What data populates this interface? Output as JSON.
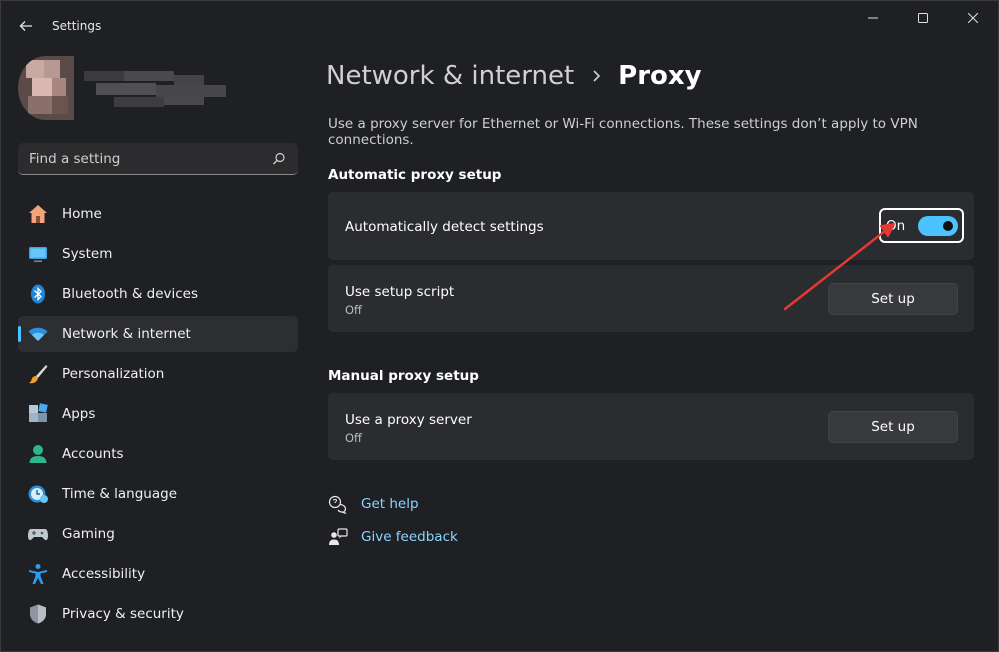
{
  "window": {
    "title": "Settings"
  },
  "sidebar": {
    "search": {
      "placeholder": "Find a setting"
    },
    "items": [
      {
        "label": "Home",
        "icon": "home-icon"
      },
      {
        "label": "System",
        "icon": "monitor-icon"
      },
      {
        "label": "Bluetooth & devices",
        "icon": "bluetooth-icon"
      },
      {
        "label": "Network & internet",
        "icon": "wifi-icon",
        "selected": true
      },
      {
        "label": "Personalization",
        "icon": "brush-icon"
      },
      {
        "label": "Apps",
        "icon": "apps-icon"
      },
      {
        "label": "Accounts",
        "icon": "person-icon"
      },
      {
        "label": "Time & language",
        "icon": "clock-globe-icon"
      },
      {
        "label": "Gaming",
        "icon": "controller-icon"
      },
      {
        "label": "Accessibility",
        "icon": "accessibility-icon"
      },
      {
        "label": "Privacy & security",
        "icon": "shield-icon"
      }
    ]
  },
  "main": {
    "breadcrumb": {
      "parent": "Network & internet",
      "current": "Proxy"
    },
    "description": "Use a proxy server for Ethernet or Wi-Fi connections. These settings don’t apply to VPN connections.",
    "automatic": {
      "title": "Automatic proxy setup",
      "detect": {
        "label": "Automatically detect settings",
        "toggle_text": "On",
        "enabled": true
      },
      "script": {
        "label": "Use setup script",
        "status": "Off",
        "button": "Set up"
      }
    },
    "manual": {
      "title": "Manual proxy setup",
      "proxy": {
        "label": "Use a proxy server",
        "status": "Off",
        "button": "Set up"
      }
    },
    "links": {
      "help": "Get help",
      "feedback": "Give feedback"
    }
  },
  "colors": {
    "accent": "#4cc2ff",
    "link": "#8ad4ff",
    "annotation_arrow": "#e53935"
  }
}
